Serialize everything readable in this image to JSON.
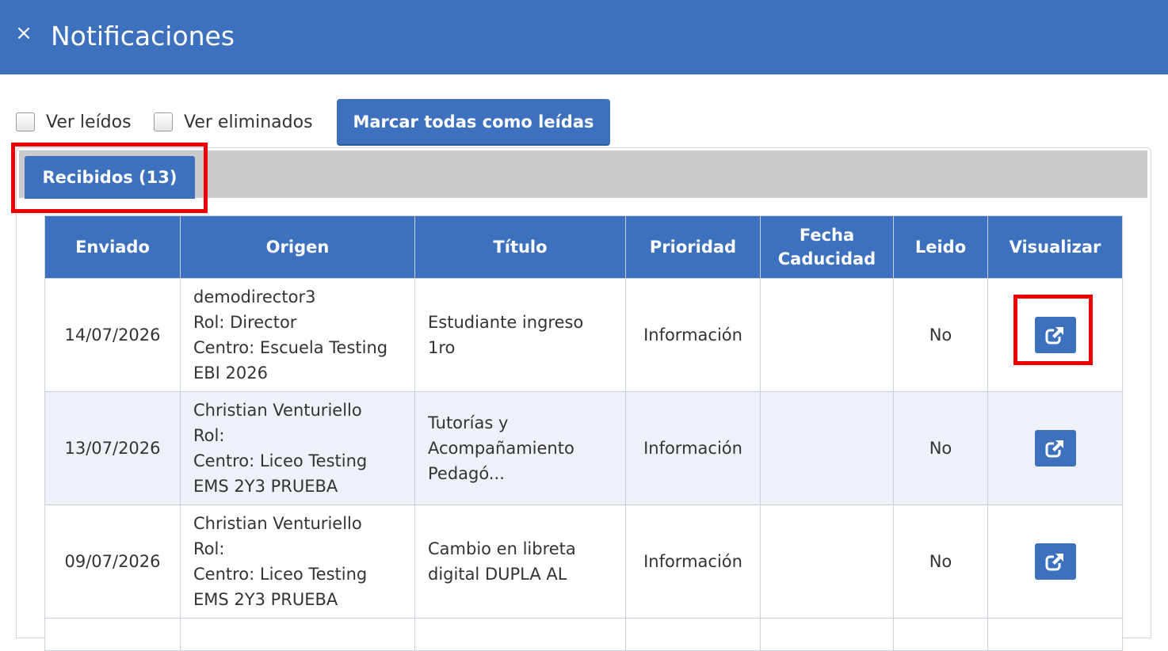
{
  "header": {
    "close_glyph": "×",
    "title": "Notificaciones"
  },
  "toolbar": {
    "ver_leidos_label": "Ver leídos",
    "ver_eliminados_label": "Ver eliminados",
    "mark_all_label": "Marcar todas como leídas"
  },
  "tabs": {
    "received_label": "Recibidos (13)"
  },
  "table": {
    "columns": [
      "Enviado",
      "Origen",
      "Título",
      "Prioridad",
      "Fecha Caducidad",
      "Leido",
      "Visualizar"
    ],
    "rows": [
      {
        "sent": "14/07/2026",
        "origin": [
          "demodirector3",
          "Rol: Director",
          "Centro: Escuela Testing",
          "EBI 2026"
        ],
        "title": [
          "Estudiante ingreso",
          "1ro"
        ],
        "priority": "Información",
        "expiry": "",
        "read": "No"
      },
      {
        "sent": "13/07/2026",
        "origin": [
          "Christian Venturiello",
          "Rol:",
          "Centro: Liceo Testing",
          "EMS 2Y3 PRUEBA"
        ],
        "title": [
          "Tutorías y",
          "Acompañamiento",
          "Pedagó..."
        ],
        "priority": "Información",
        "expiry": "",
        "read": "No"
      },
      {
        "sent": "09/07/2026",
        "origin": [
          "Christian Venturiello",
          "Rol:",
          "Centro: Liceo Testing",
          "EMS 2Y3 PRUEBA"
        ],
        "title": [
          "Cambio en libreta",
          "digital DUPLA AL"
        ],
        "priority": "Información",
        "expiry": "",
        "read": "No"
      }
    ]
  },
  "icons": {
    "view": "external-link-icon",
    "close": "close-icon",
    "checkbox": "checkbox-icon"
  },
  "colors": {
    "primary": "#3d71be",
    "highlight": "#ee0000",
    "tab_bar": "#cbcbcb",
    "row_alt": "#eef2f8"
  }
}
